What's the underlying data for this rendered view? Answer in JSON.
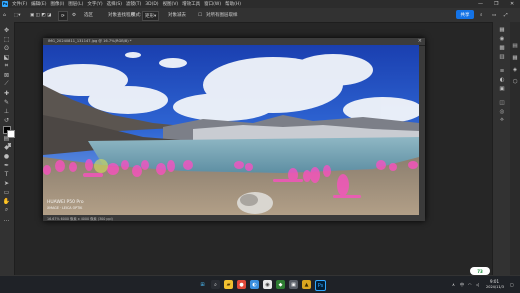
{
  "app": {
    "logo": "Ps"
  },
  "menubar": {
    "items": [
      "文件(F)",
      "编辑(E)",
      "图像(I)",
      "图层(L)",
      "文字(Y)",
      "选择(S)",
      "滤镜(T)",
      "3D(D)",
      "视图(V)",
      "增效工具",
      "窗口(W)",
      "帮助(H)"
    ],
    "window_controls": [
      "—",
      "❐",
      "✕"
    ]
  },
  "options_bar": {
    "mode_label": "选区",
    "mode_value": "对象查找程序",
    "sample_label": "模式:",
    "sample_value": "矩形",
    "object_label": "对象减去",
    "option_value": "",
    "refresh_label": "",
    "checkbox_label": "对所有图层取样",
    "share_label": "共享"
  },
  "document": {
    "tab_title": "IMG_20240811_131147.jpg @ 16.7%(RGB/8) *",
    "status": "16.67%   6000 像素 x 4000 像素 (300 ppi)",
    "watermark_brand": "HUAWEI P50 Pro",
    "watermark_sub": "XMAGE · LEICA OPTIK"
  },
  "taskbar": {
    "time": "9:01",
    "date": "2024/11/3",
    "lang": "中",
    "weather_badge": "73"
  },
  "colors": {
    "accent": "#1473e6",
    "ps_blue": "#31a8ff",
    "selection_overlay": "#ff4dc4"
  }
}
